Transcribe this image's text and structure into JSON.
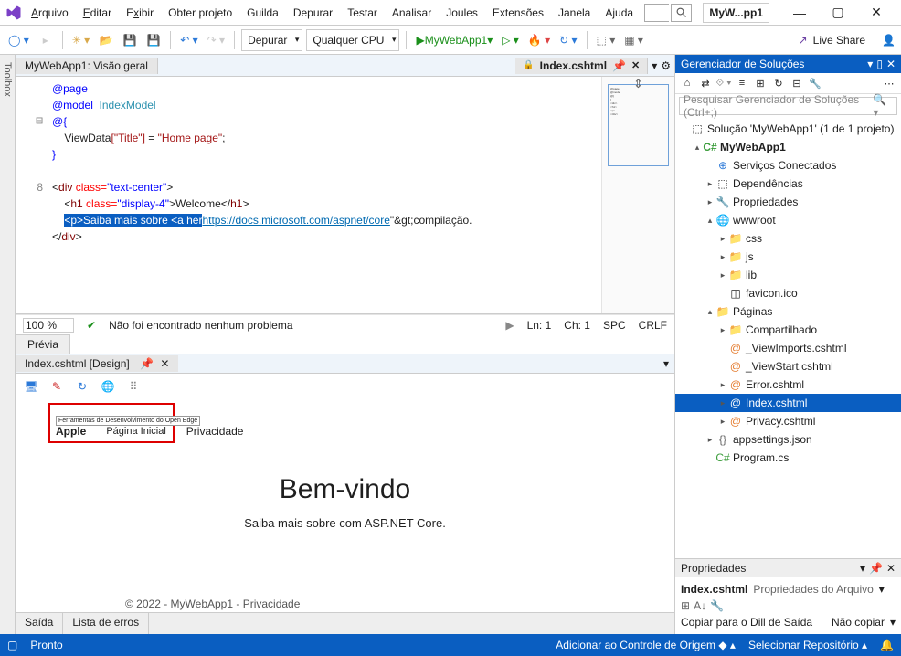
{
  "menu": [
    "Arquivo",
    "Editar",
    "Exibir",
    "Obter projeto",
    "Guilda",
    "Depurar",
    "Testar",
    "Analisar",
    "Joules",
    "Extensões",
    "Janela",
    "Ajuda"
  ],
  "menu_accel": [
    "A",
    "E",
    "x"
  ],
  "app_name": "MyW...pp1",
  "toolbar": {
    "config": "Depurar",
    "cpu": "Qualquer CPU",
    "run": "MyWebApp1",
    "liveshare": "Live Share"
  },
  "toolbox": "Toolbox",
  "doc_tab_main": "MyWebApp1: Visão geral",
  "doc_tab_active": "Index.cshtml",
  "code": {
    "l1": "@page",
    "l2a": "@model",
    "l2b": "IndexModel",
    "l3": "@{",
    "l4_key": "ViewData",
    "l4_idx": "[\"Title\"]",
    "l4_val": "\"Home page\"",
    "l5": "}",
    "ln8": "8",
    "div_open_tag": "div",
    "div_attr": "class=",
    "div_val": "\"text-center\"",
    "h1_tag": "h1",
    "h1_attr": "class=",
    "h1_val": "\"display-4\"",
    "h1_text": "Welcome",
    "p_hl": "<p>Saiba mais sobre <a her",
    "url": "https://docs.microsoft.com/aspnet/core",
    "tail": "\"&gt;compilação.",
    "div_close": "div"
  },
  "code_status": {
    "zoom": "100 %",
    "issues": "Não foi encontrado nenhum problema",
    "ln": "Ln: 1",
    "ch": "Ch: 1",
    "spc": "SPC",
    "crlf": "CRLF"
  },
  "preview_tab": "Prévia",
  "design_tab": "Index.cshtml [Design]",
  "design": {
    "tooltip": "Ferramentas de Desenvolvimento do Open Edge",
    "apple": "Apple",
    "home": "Página Inicial",
    "privacy": "Privacidade",
    "h1": "Bem-vindo",
    "lead": "Saiba mais sobre com ASP.NET Core.",
    "footer_year": "© 2022 - ",
    "footer_app": "MyWebApp1 - Privacidade"
  },
  "bottom_tabs": [
    "Saída",
    "Lista de erros"
  ],
  "sol": {
    "title": "Gerenciador de Soluções",
    "search_ph": "Pesquisar Gerenciador de Soluções (Ctrl+;)",
    "root": "Solução 'MyWebApp1' (1 de 1 projeto)",
    "project": "MyWebApp1",
    "items": {
      "connected": "Serviços Conectados",
      "deps": "Dependências",
      "props": "Propriedades",
      "wwwroot": "wwwroot",
      "css": "css",
      "js": "js",
      "lib": "lib",
      "favicon": "favicon.ico",
      "pages": "Páginas",
      "shared": "Compartilhado",
      "viewimports": "_ViewImports.cshtml",
      "viewstart": "_ViewStart.cshtml",
      "error": "Error.cshtml",
      "index": "Index.cshtml",
      "privacy": "Privacy.cshtml",
      "appsettings": "appsettings.json",
      "program": "Program.cs"
    }
  },
  "props": {
    "title": "Propriedades",
    "file": "Index.cshtml",
    "filetype": "Propriedades do Arquivo",
    "copylbl": "Copiar para o Dill de Saída",
    "copyval": "Não copiar"
  },
  "status": {
    "ready": "Pronto",
    "add_src": "Adicionar ao Controle de Origem",
    "sel_repo": "Selecionar Repositório"
  }
}
